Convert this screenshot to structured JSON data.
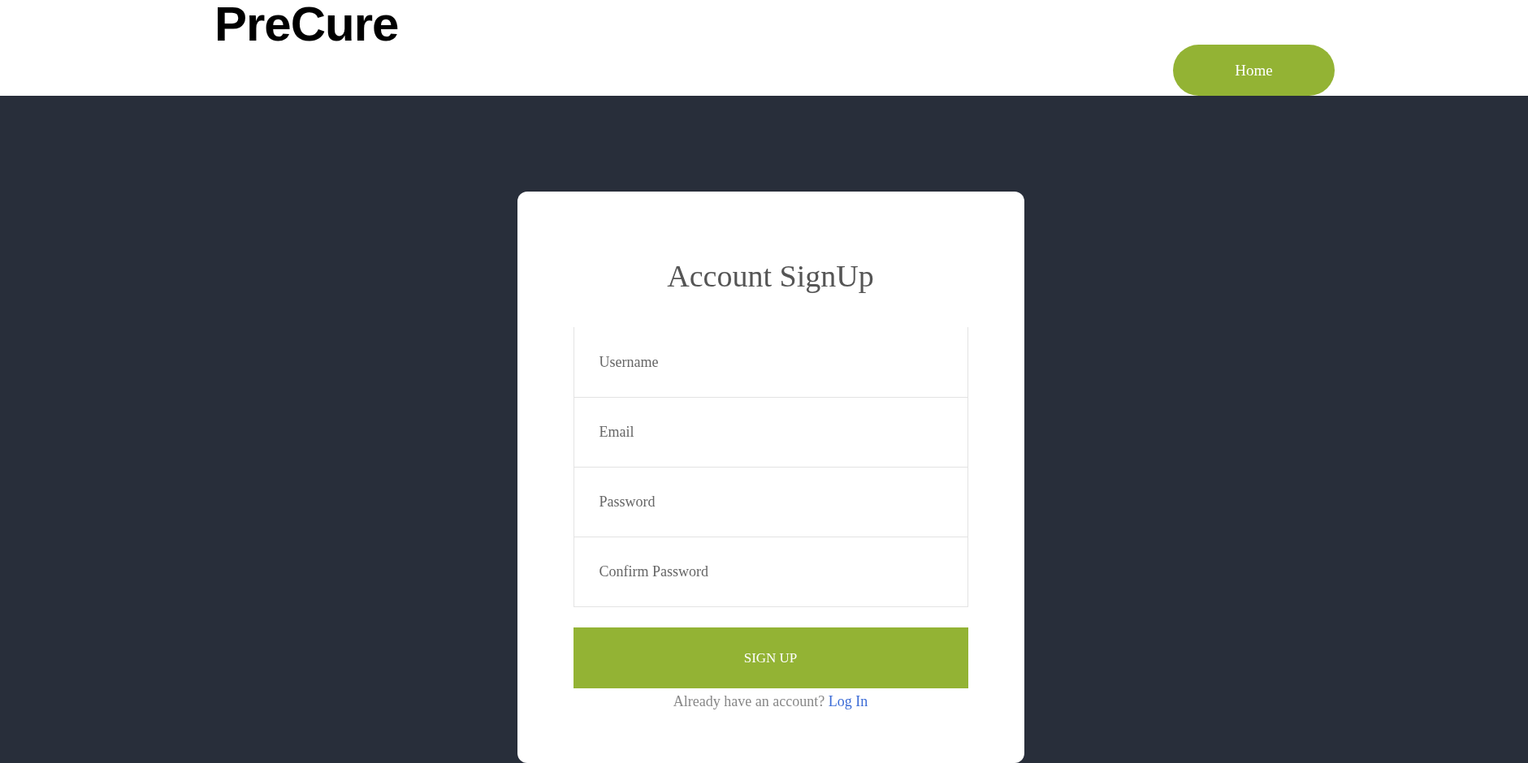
{
  "header": {
    "logo": "PreCure",
    "nav": [
      {
        "label": "Home"
      }
    ]
  },
  "signup": {
    "title": "Account SignUp",
    "fields": [
      {
        "placeholder": "Username"
      },
      {
        "placeholder": "Email"
      },
      {
        "placeholder": "Password"
      },
      {
        "placeholder": "Confirm Password"
      }
    ],
    "submit": "SIGN UP",
    "prompt": "Already have an account?",
    "link": "Log In"
  }
}
